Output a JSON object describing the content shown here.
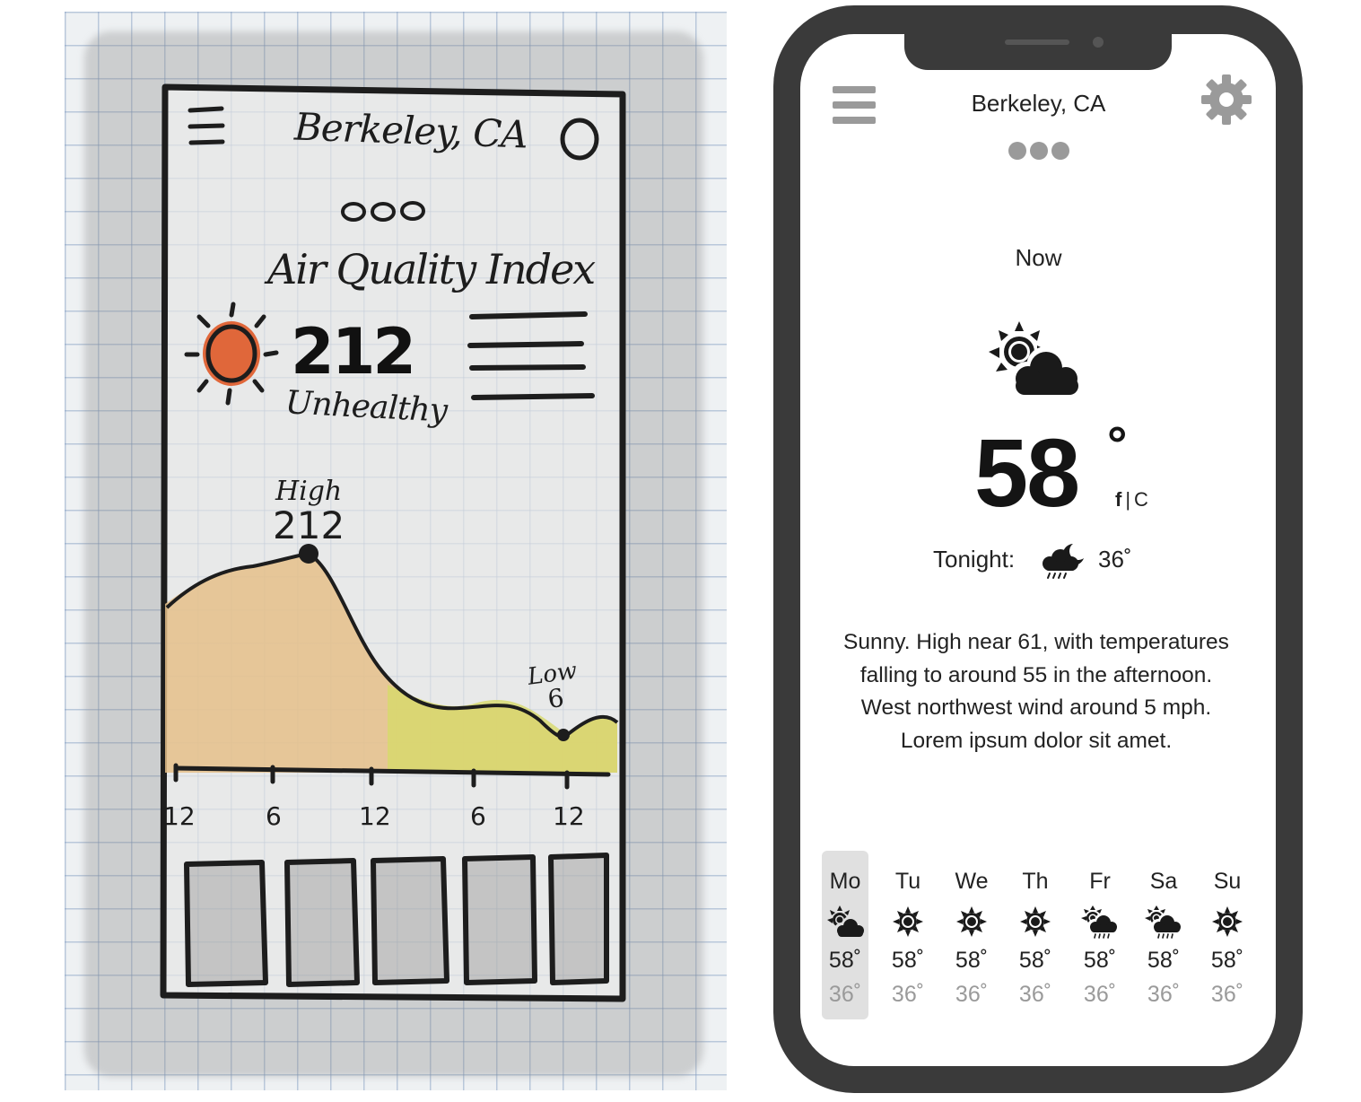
{
  "sketch": {
    "title": "Berkeley, CA",
    "heading": "Air Quality Index",
    "aqi_value": "212",
    "aqi_status": "Unhealthy",
    "high_label": "High",
    "high_value": "212",
    "low_label": "Low",
    "low_value": "6",
    "time_ticks": [
      "12",
      "6",
      "12",
      "6",
      "12"
    ],
    "colors": {
      "sun": "#e0673a",
      "chart_fill": "#e5c08a",
      "chart_fill_low": "#d7d96a",
      "ink": "#1d1d1d"
    }
  },
  "phone": {
    "location": "Berkeley, CA",
    "menu_icon": "hamburger-menu-icon",
    "settings_icon": "gear-icon",
    "page_indicator_count": 3,
    "now_label": "Now",
    "current_condition_icon": "partly-cloudy-icon",
    "current_temp": "58",
    "degree_symbol": "°",
    "unit_f": "f",
    "unit_separator": "|",
    "unit_c": "C",
    "tonight_label": "Tonight:",
    "tonight_icon": "night-rain-icon",
    "tonight_temp": "36˚",
    "forecast": [
      "Sunny. High near 61, with temperatures",
      "falling to around 55 in the afternoon.",
      "West northwest wind around 5 mph.",
      "Lorem ipsum dolor sit amet."
    ],
    "week": [
      {
        "day": "Mo",
        "icon": "partly-cloudy-icon",
        "high": "58˚",
        "low": "36˚",
        "selected": true
      },
      {
        "day": "Tu",
        "icon": "sun-icon",
        "high": "58˚",
        "low": "36˚"
      },
      {
        "day": "We",
        "icon": "sun-icon",
        "high": "58˚",
        "low": "36˚"
      },
      {
        "day": "Th",
        "icon": "sun-icon",
        "high": "58˚",
        "low": "36˚"
      },
      {
        "day": "Fr",
        "icon": "sun-rain-cloud-icon",
        "high": "58˚",
        "low": "36˚"
      },
      {
        "day": "Sa",
        "icon": "sun-rain-cloud-icon",
        "high": "58˚",
        "low": "36˚"
      },
      {
        "day": "Su",
        "icon": "sun-icon",
        "high": "58˚",
        "low": "36˚"
      }
    ],
    "colors": {
      "frame": "#3a3a3a",
      "icon_gray": "#9a9a9a",
      "text": "#222222",
      "low_temp": "#9a9a9a",
      "selected_bg": "#e0e0e0"
    }
  }
}
